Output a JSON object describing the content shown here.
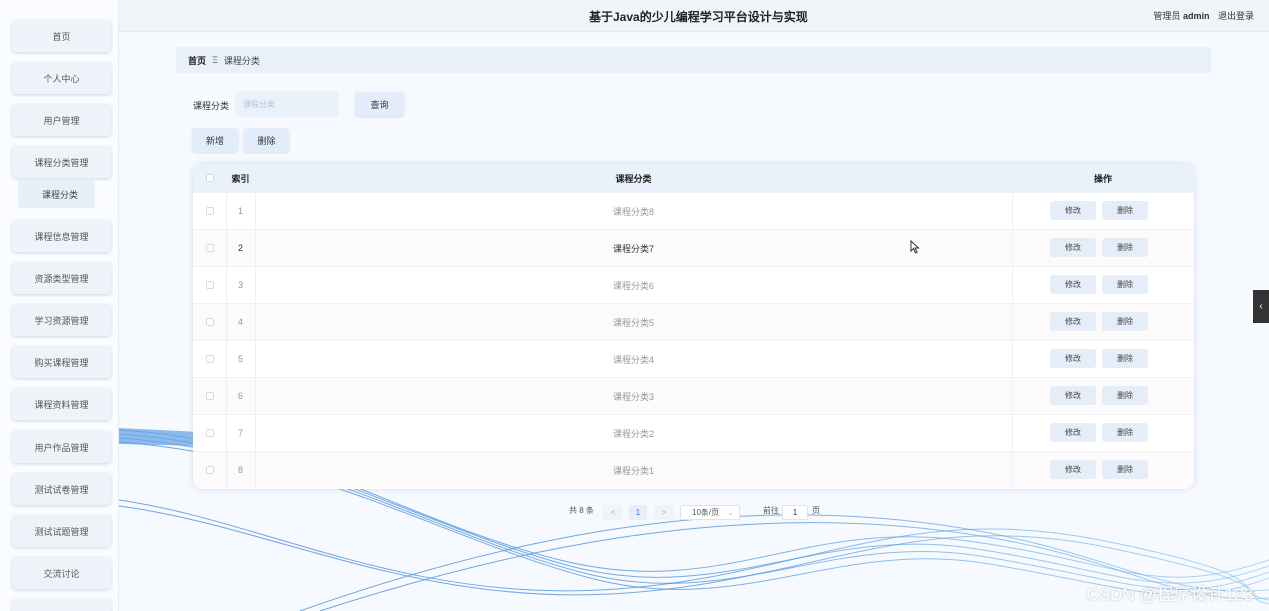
{
  "colors": {
    "accent": "#3a79d8",
    "panel": "#e9f1fb",
    "wave": "#4a8fd8"
  },
  "header": {
    "title": "基于Java的少儿编程学习平台设计与实现",
    "role": "管理员",
    "username": "admin",
    "logout": "退出登录"
  },
  "sidebar": {
    "items": [
      {
        "label": "首页"
      },
      {
        "label": "个人中心"
      },
      {
        "label": "用户管理"
      },
      {
        "label": "课程分类管理"
      },
      {
        "label": "课程信息管理"
      },
      {
        "label": "资源类型管理"
      },
      {
        "label": "学习资源管理"
      },
      {
        "label": "购买课程管理"
      },
      {
        "label": "课程资料管理"
      },
      {
        "label": "用户作品管理"
      },
      {
        "label": "测试试卷管理"
      },
      {
        "label": "测试试题管理"
      },
      {
        "label": "交流讨论"
      }
    ],
    "sub_item": "课程分类"
  },
  "breadcrumb": {
    "home": "首页",
    "separator": "Ξ",
    "current": "课程分类"
  },
  "search": {
    "label": "课程分类",
    "placeholder": "课程分类",
    "button": "查询"
  },
  "actions": {
    "add": "新增",
    "delete": "删除"
  },
  "table": {
    "columns": {
      "index": "索引",
      "category": "课程分类",
      "operation": "操作"
    },
    "edit_label": "修改",
    "delete_label": "删除",
    "rows": [
      {
        "index": "1",
        "name": "课程分类8"
      },
      {
        "index": "2",
        "name": "课程分类7"
      },
      {
        "index": "3",
        "name": "课程分类6"
      },
      {
        "index": "4",
        "name": "课程分类5"
      },
      {
        "index": "5",
        "name": "课程分类4"
      },
      {
        "index": "6",
        "name": "课程分类3"
      },
      {
        "index": "7",
        "name": "课程分类2"
      },
      {
        "index": "8",
        "name": "课程分类1"
      }
    ]
  },
  "pagination": {
    "total": "共 8 条",
    "prev": "<",
    "current_page": "1",
    "next": ">",
    "page_size": "10条/页",
    "goto_label": "前往",
    "goto_value": "1",
    "page_unit": "页"
  },
  "side_toggle": "‹",
  "watermark": "CSDN @程序设计123"
}
